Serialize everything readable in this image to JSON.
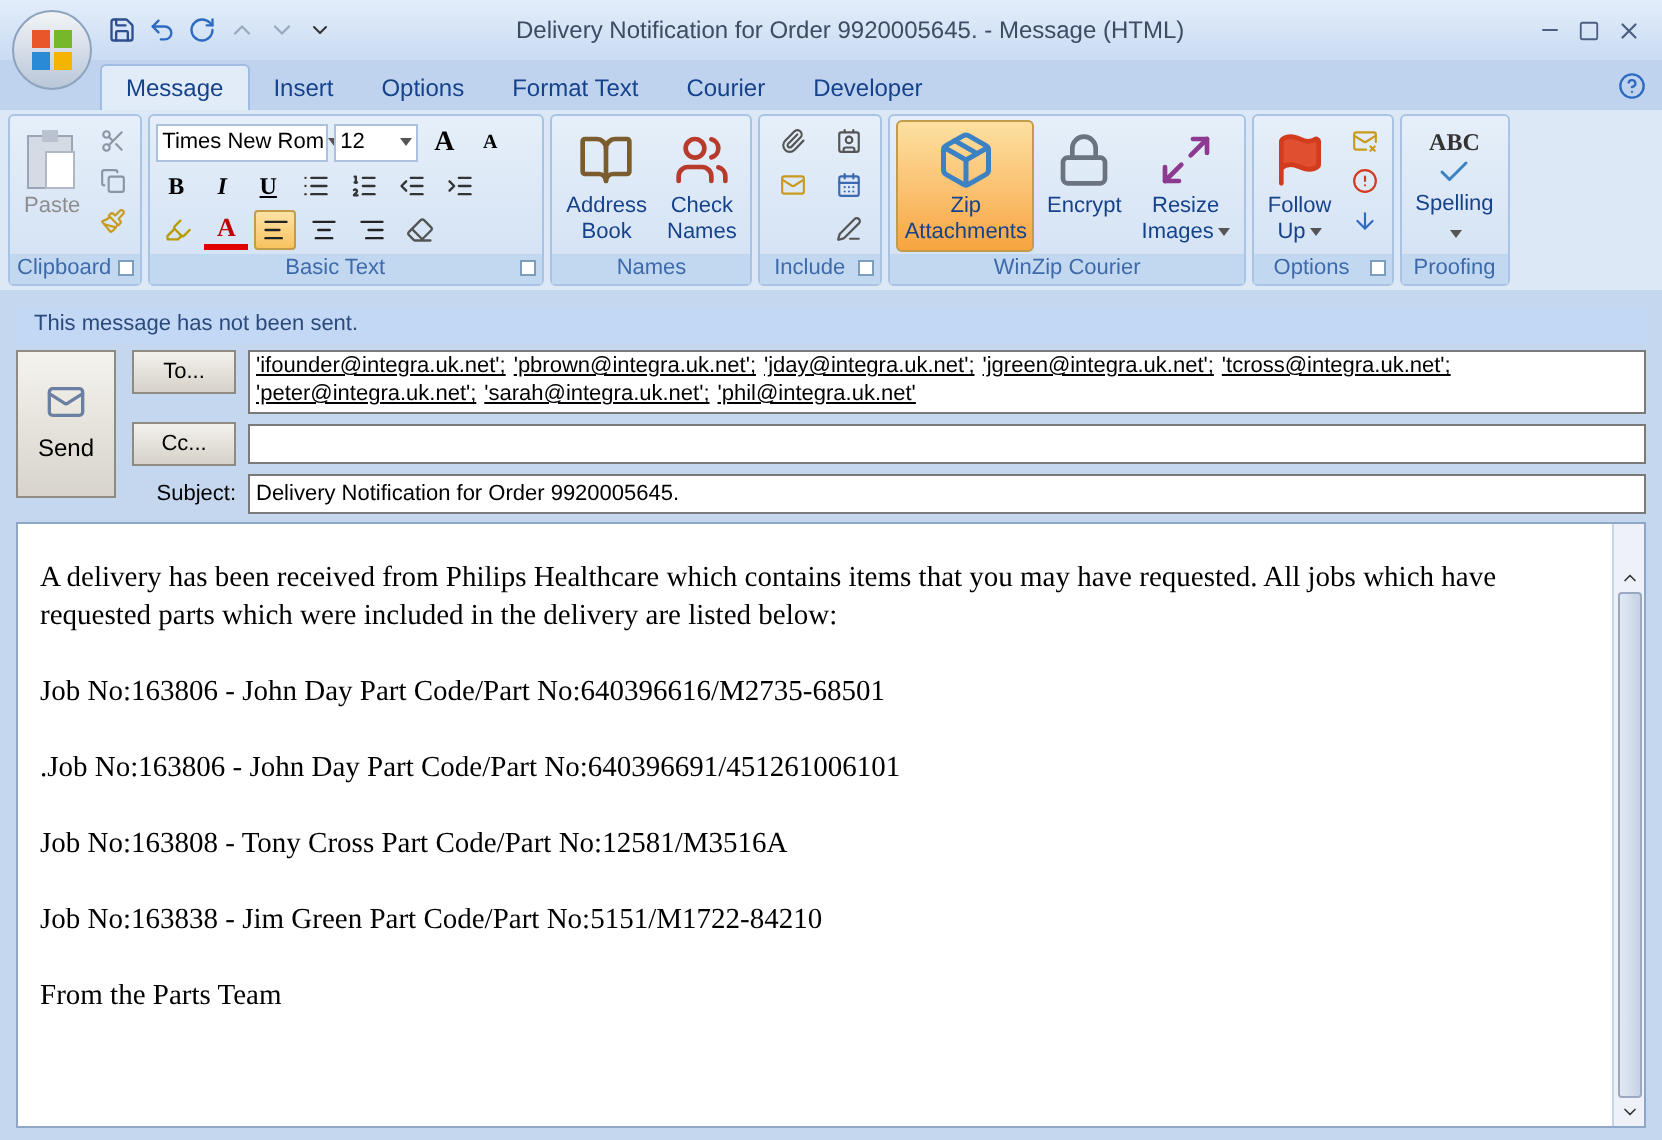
{
  "window": {
    "title": "Delivery Notification for Order 9920005645. - Message (HTML)"
  },
  "tabs": [
    {
      "label": "Message",
      "selected": true
    },
    {
      "label": "Insert",
      "selected": false
    },
    {
      "label": "Options",
      "selected": false
    },
    {
      "label": "Format Text",
      "selected": false
    },
    {
      "label": "Courier",
      "selected": false
    },
    {
      "label": "Developer",
      "selected": false
    }
  ],
  "ribbon": {
    "clipboard": {
      "label": "Clipboard",
      "paste": {
        "label": "Paste",
        "disabled": true
      }
    },
    "basic_text": {
      "label": "Basic Text",
      "font_name": "Times New Rom",
      "font_size": "12",
      "grow": "A",
      "shrink": "A",
      "bold": "B",
      "italic": "I",
      "underline": "U",
      "font_color": "A",
      "alignment": [
        {
          "kind": "left",
          "selected": true
        },
        {
          "kind": "center",
          "selected": false
        },
        {
          "kind": "right",
          "selected": false
        }
      ]
    },
    "names": {
      "label": "Names",
      "buttons": [
        "Address Book",
        "Check Names"
      ]
    },
    "include": {
      "label": "Include"
    },
    "winzip": {
      "label": "WinZip Courier",
      "buttons": [
        {
          "label": "Zip Attachments",
          "selected": true,
          "dropdown": false
        },
        {
          "label": "Encrypt",
          "selected": false,
          "dropdown": false
        },
        {
          "label": "Resize Images",
          "selected": false,
          "dropdown": true
        }
      ]
    },
    "options": {
      "label": "Options",
      "follow_up": "Follow Up"
    },
    "proofing": {
      "label": "Proofing",
      "spelling": "Spelling",
      "icon_text": "ABC"
    }
  },
  "info_bar": "This message has not been sent.",
  "send": "Send",
  "to_button": "To...",
  "cc_button": "Cc...",
  "recipients": [
    {
      "address": "'ifounder@integra.uk.net';"
    },
    {
      "address": "'pbrown@integra.uk.net';"
    },
    {
      "address": "'jday@integra.uk.net';"
    },
    {
      "address": "'jgreen@integra.uk.net';"
    },
    {
      "address": "'tcross@integra.uk.net';"
    },
    {
      "address": "'peter@integra.uk.net';"
    },
    {
      "address": "'sarah@integra.uk.net';"
    },
    {
      "address": "'phil@integra.uk.net'"
    }
  ],
  "subject_label": "Subject:",
  "subject": "Delivery Notification for Order 9920005645.",
  "body": [
    "A delivery has been received from Philips Healthcare which contains items that you may have requested. All jobs which have requested parts which were included in the delivery are listed below:",
    "Job No:163806 - John Day Part Code/Part No:640396616/M2735-68501",
    ".Job No:163806 - John Day Part Code/Part No:640396691/451261006101",
    "Job No:163808 - Tony Cross Part Code/Part No:12581/M3516A",
    "Job No:163838 - Jim Green Part Code/Part No:5151/M1722-84210",
    "From the Parts Team"
  ]
}
